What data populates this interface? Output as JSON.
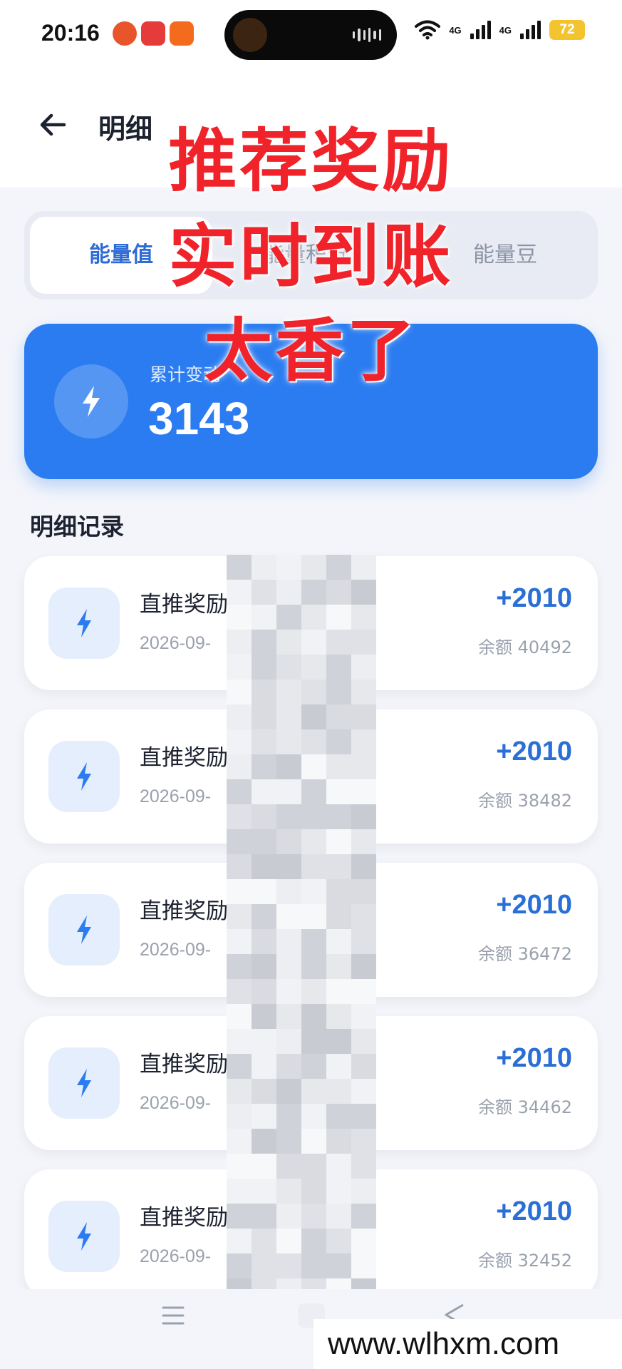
{
  "status_bar": {
    "time": "20:16",
    "signal_1": "4G",
    "signal_2": "4G",
    "battery": "72"
  },
  "header": {
    "title": "明细",
    "back_icon": "arrow-left-icon"
  },
  "tabs": [
    {
      "label": "能量值",
      "active": true
    },
    {
      "label": "能量积分",
      "active": false
    },
    {
      "label": "能量豆",
      "active": false
    }
  ],
  "summary": {
    "label": "累计变动",
    "value": "3143",
    "icon": "lightning-icon"
  },
  "records_section": {
    "title": "明细记录"
  },
  "records": [
    {
      "title": "直推奖励",
      "date": "2026-09-",
      "amount": "+2010",
      "balance": "余额 40492"
    },
    {
      "title": "直推奖励",
      "date": "2026-09-",
      "amount": "+2010",
      "balance": "余额 38482"
    },
    {
      "title": "直推奖励",
      "date": "2026-09-",
      "amount": "+2010",
      "balance": "余额 36472"
    },
    {
      "title": "直推奖励",
      "date": "2026-09-",
      "amount": "+2010",
      "balance": "余额 34462"
    },
    {
      "title": "直推奖励",
      "date": "2026-09-",
      "amount": "+2010",
      "balance": "余额 32452"
    }
  ],
  "overlay_caption": [
    "推荐奖励",
    "实时到账",
    "太香了"
  ],
  "watermark": "www.wlhxm.com",
  "colors": {
    "accent_blue": "#2b7cf0",
    "amount_blue": "#2a6fd6",
    "caption_red": "#f0232a",
    "page_bg": "#f3f5fa"
  }
}
